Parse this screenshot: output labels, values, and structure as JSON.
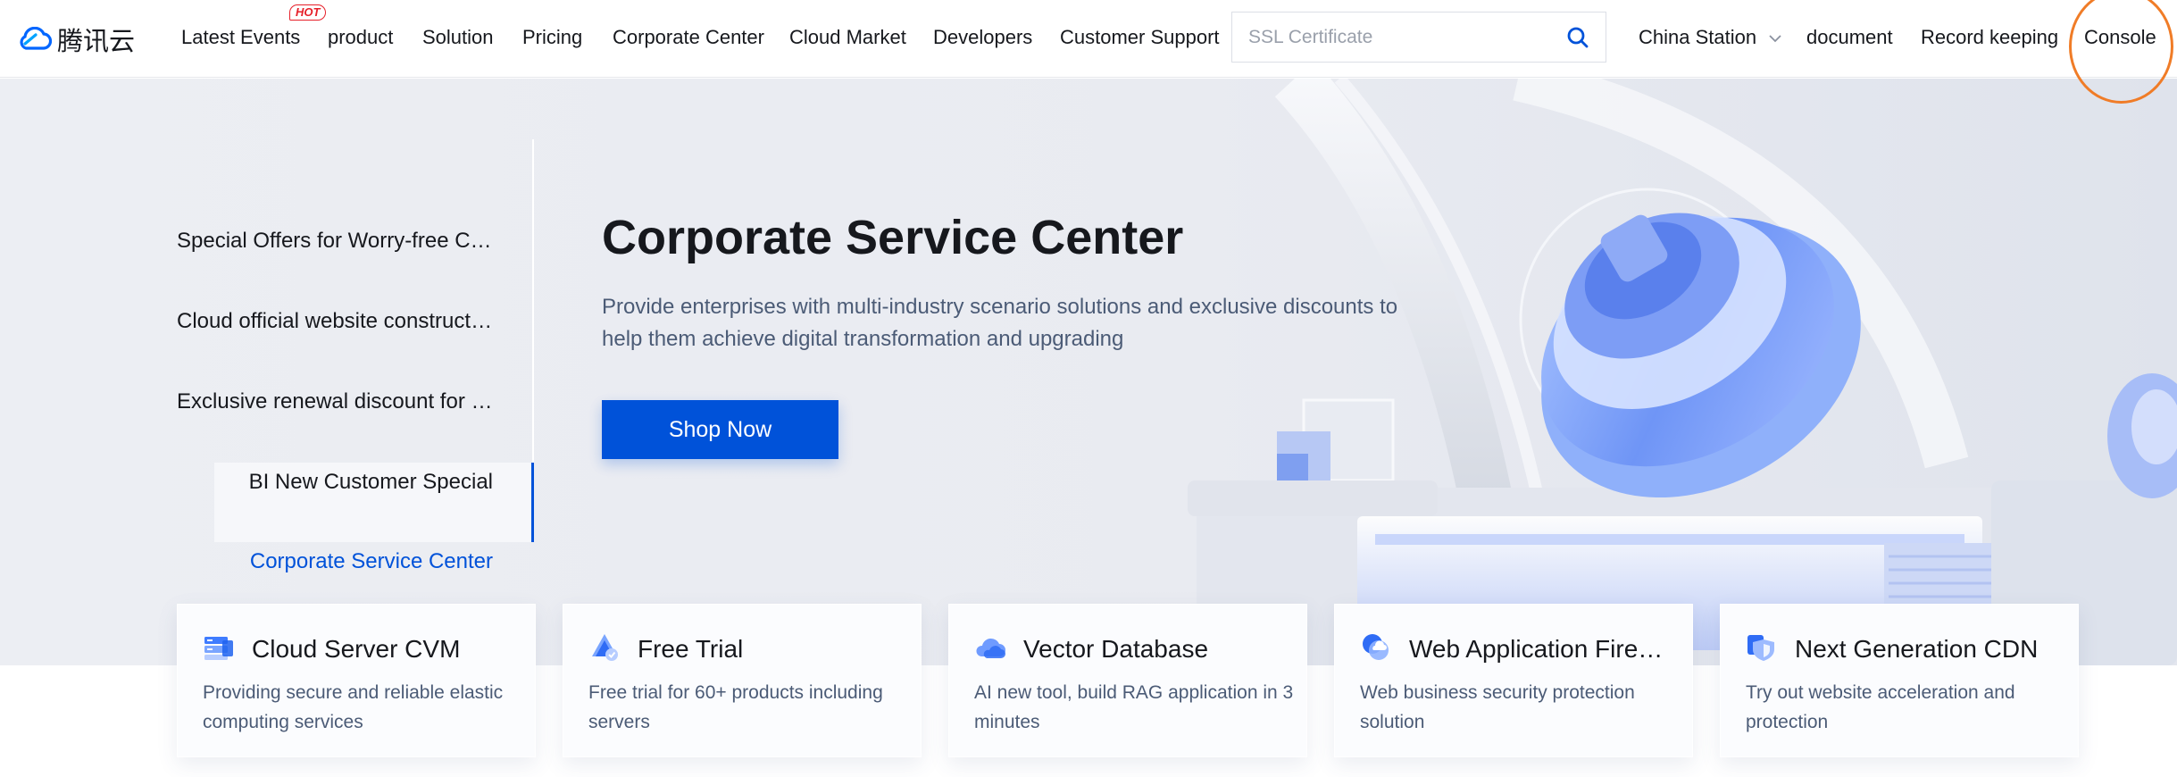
{
  "logo": {
    "text": "腾讯云"
  },
  "nav": {
    "items": [
      "Latest Events",
      "product",
      "Solution",
      "Pricing",
      "Corporate Center",
      "Cloud Market",
      "Developers",
      "Customer Support"
    ],
    "hot_badge": "HOT",
    "search_placeholder": "SSL Certificate",
    "station": "China Station",
    "document": "document",
    "record": "Record keeping",
    "console": "Console"
  },
  "sidebar": {
    "items": [
      "Special Offers for Worry-free Cloud Migration",
      "Cloud official website construction",
      "Exclusive renewal discount for enterprises",
      "BI New Customer Special",
      "Corporate Service Center"
    ],
    "active_index": 4
  },
  "hero": {
    "title": "Corporate Service Center",
    "description": "Provide enterprises with multi-industry scenario solutions and exclusive discounts to help them achieve digital transformation and upgrading",
    "button": "Shop Now"
  },
  "cards": [
    {
      "title": "Cloud Server CVM",
      "desc": "Providing secure and reliable elastic computing services",
      "icon": "server-icon"
    },
    {
      "title": "Free Trial",
      "desc": "Free trial for 60+ products including servers",
      "icon": "gift-icon"
    },
    {
      "title": "Vector Database",
      "desc": "AI new tool, build RAG application in 3 minutes",
      "icon": "cloud-database-icon"
    },
    {
      "title": "Web Application Firewall",
      "desc": "Web business security protection solution",
      "icon": "firewall-icon"
    },
    {
      "title": "Next Generation CDN",
      "desc": "Try out website acceleration and protection",
      "icon": "shield-icon"
    }
  ],
  "colors": {
    "brand": "#0052d9",
    "hot": "#e6202a",
    "highlight_ring": "#f07c27",
    "hero_bg": "#eceef3"
  }
}
